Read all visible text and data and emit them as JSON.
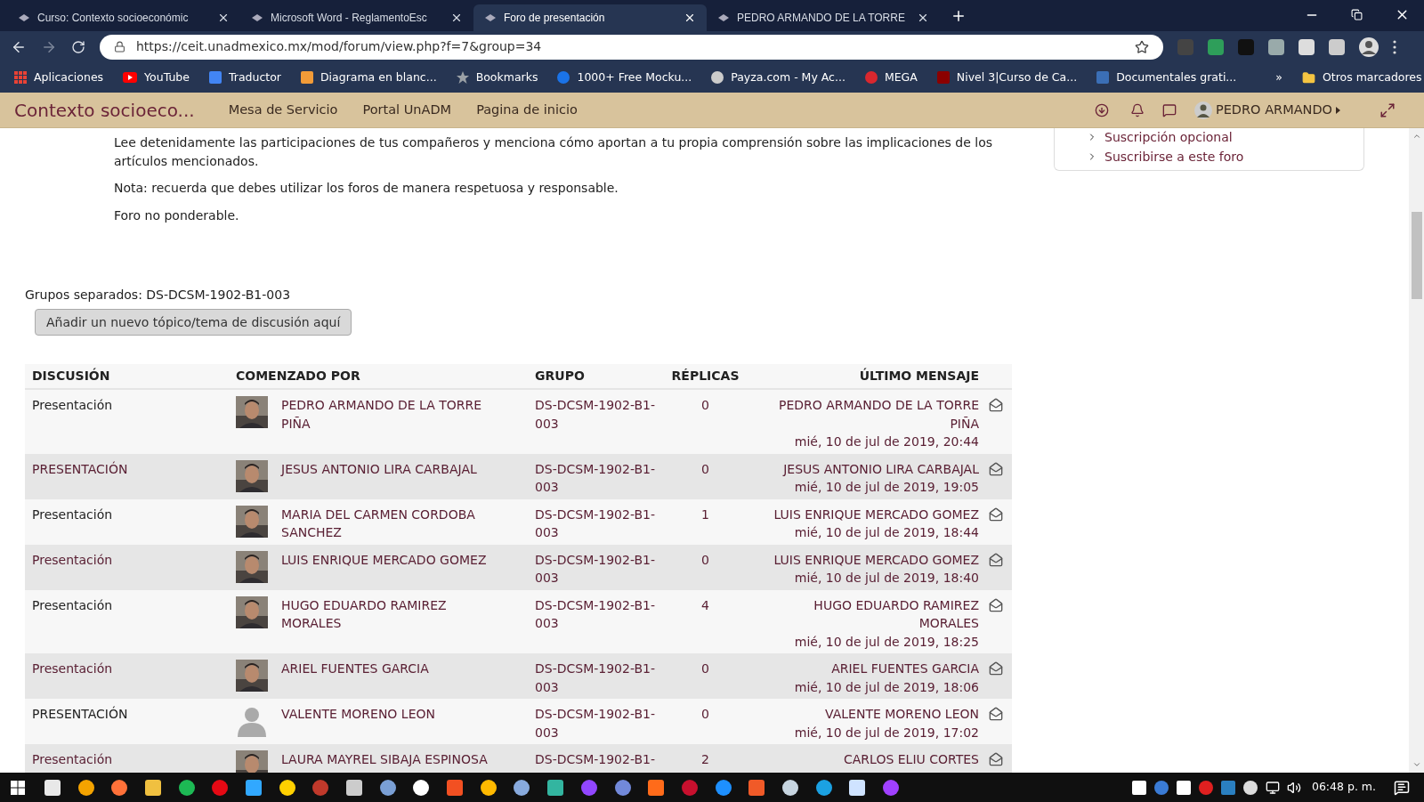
{
  "browser": {
    "tabs": [
      {
        "title": "Curso: Contexto socioeconómic",
        "selected": false
      },
      {
        "title": "Microsoft Word - ReglamentoEsc",
        "selected": false
      },
      {
        "title": "Foro de presentación",
        "selected": true
      },
      {
        "title": "PEDRO ARMANDO DE LA TORRE",
        "selected": false
      }
    ],
    "url": "https://ceit.unadmexico.mx/mod/forum/view.php?f=7&group=34",
    "bookmarks": [
      {
        "label": "Aplicaciones",
        "kind": "grid",
        "color": "#e94235"
      },
      {
        "label": "YouTube",
        "kind": "play",
        "color": "#ff0000"
      },
      {
        "label": "Traductor",
        "kind": "square",
        "color": "#4285f4"
      },
      {
        "label": "Diagrama en blanc...",
        "kind": "square",
        "color": "#f29b38"
      },
      {
        "label": "Bookmarks",
        "kind": "star",
        "color": "#9aa0a6"
      },
      {
        "label": "1000+ Free Mocku...",
        "kind": "circle",
        "color": "#1a73e8"
      },
      {
        "label": "Payza.com - My Ac...",
        "kind": "circle",
        "color": "#cccccc"
      },
      {
        "label": "MEGA",
        "kind": "circle",
        "color": "#d9272e"
      },
      {
        "label": "Nivel 3|Curso de Ca...",
        "kind": "square",
        "color": "#8b0000"
      },
      {
        "label": "Documentales grati...",
        "kind": "square",
        "color": "#3b6fb6"
      }
    ],
    "more": "»",
    "other_bookmarks": "Otros marcadores"
  },
  "site_nav": {
    "brand": "Contexto socioeco...",
    "links": [
      "Mesa de Servicio",
      "Portal UnADM",
      "Pagina de inicio"
    ],
    "user": "PEDRO ARMANDO"
  },
  "sidebar": {
    "items": [
      "Suscripción opcional",
      "Suscribirse a este foro"
    ]
  },
  "intro": [
    "Lee detenidamente las participaciones de tus compañeros y menciona cómo aportan a tu propia comprensión sobre las implicaciones de los artículos mencionados.",
    "Nota: recuerda que debes utilizar los foros de manera respetuosa y responsable.",
    "Foro no ponderable."
  ],
  "groups_label": "Grupos separados: DS-DCSM-1902-B1-003",
  "add_button": "Añadir un nuevo tópico/tema de discusión aquí",
  "table": {
    "columns": [
      "DISCUSIÓN",
      "COMENZADO POR",
      "GRUPO",
      "RÉPLICAS",
      "ÚLTIMO MENSAJE"
    ],
    "rows": [
      {
        "discussion": "Presentación",
        "default_avatar": false,
        "starter": "PEDRO ARMANDO DE LA TORRE PIÑA",
        "group": "DS-DCSM-1902-B1-003",
        "replies": "0",
        "last_author": "PEDRO ARMANDO DE LA TORRE PIÑA",
        "last_date": "mié, 10 de jul de 2019, 20:44"
      },
      {
        "discussion": "PRESENTACIÓN",
        "default_avatar": false,
        "starter": "JESUS ANTONIO LIRA CARBAJAL",
        "group": "DS-DCSM-1902-B1-003",
        "replies": "0",
        "last_author": "JESUS ANTONIO LIRA CARBAJAL",
        "last_date": "mié, 10 de jul de 2019, 19:05"
      },
      {
        "discussion": "Presentación",
        "default_avatar": false,
        "starter": "MARIA DEL CARMEN CORDOBA SANCHEZ",
        "group": "DS-DCSM-1902-B1-003",
        "replies": "1",
        "last_author": "LUIS ENRIQUE MERCADO GOMEZ",
        "last_date": "mié, 10 de jul de 2019, 18:44"
      },
      {
        "discussion": "Presentación",
        "default_avatar": false,
        "starter": "LUIS ENRIQUE MERCADO GOMEZ",
        "group": "DS-DCSM-1902-B1-003",
        "replies": "0",
        "last_author": "LUIS ENRIQUE MERCADO GOMEZ",
        "last_date": "mié, 10 de jul de 2019, 18:40"
      },
      {
        "discussion": "Presentación",
        "default_avatar": false,
        "starter": "HUGO EDUARDO RAMIREZ MORALES",
        "group": "DS-DCSM-1902-B1-003",
        "replies": "4",
        "last_author": "HUGO EDUARDO RAMIREZ MORALES",
        "last_date": "mié, 10 de jul de 2019, 18:25"
      },
      {
        "discussion": "Presentación",
        "default_avatar": false,
        "starter": "ARIEL FUENTES GARCIA",
        "group": "DS-DCSM-1902-B1-003",
        "replies": "0",
        "last_author": "ARIEL FUENTES GARCIA",
        "last_date": "mié, 10 de jul de 2019, 18:06"
      },
      {
        "discussion": "PRESENTACIÓN",
        "default_avatar": true,
        "starter": "VALENTE MORENO LEON",
        "group": "DS-DCSM-1902-B1-003",
        "replies": "0",
        "last_author": "VALENTE MORENO LEON",
        "last_date": "mié, 10 de jul de 2019, 17:02"
      },
      {
        "discussion": "Presentación",
        "default_avatar": false,
        "starter": "LAURA MAYREL SIBAJA ESPINOSA",
        "group": "DS-DCSM-1902-B1-",
        "replies": "2",
        "last_author": "CARLOS ELIU CORTES"
      }
    ]
  },
  "taskbar": {
    "clock": "06:48 p. m."
  }
}
